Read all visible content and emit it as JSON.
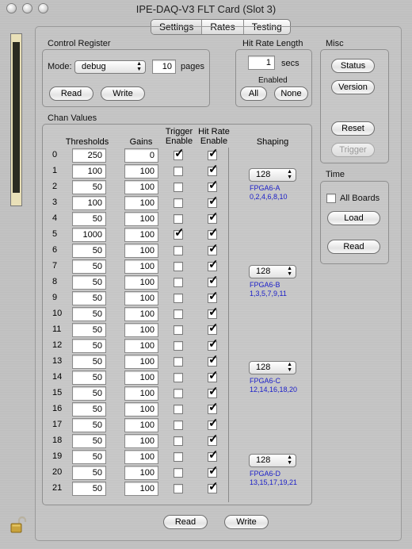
{
  "window": {
    "title": "IPE-DAQ-V3 FLT Card (Slot 3)"
  },
  "tabs": [
    {
      "label": "Settings",
      "selected": true
    },
    {
      "label": "Rates",
      "selected": false
    },
    {
      "label": "Testing",
      "selected": false
    }
  ],
  "control_register": {
    "title": "Control Register",
    "mode_label": "Mode:",
    "mode_value": "debug",
    "pages_value": "10",
    "pages_label": "pages",
    "read_label": "Read",
    "write_label": "Write"
  },
  "hit_rate": {
    "title": "Hit Rate Length",
    "secs_value": "1",
    "secs_label": "secs",
    "enabled_label": "Enabled",
    "all_label": "All",
    "none_label": "None"
  },
  "misc": {
    "title": "Misc",
    "status_label": "Status",
    "version_label": "Version",
    "reset_label": "Reset",
    "trigger_label": "Trigger"
  },
  "time": {
    "title": "Time",
    "all_boards_label": "All Boards",
    "all_boards_checked": false,
    "load_label": "Load",
    "read_label": "Read"
  },
  "chan_values": {
    "title": "Chan Values",
    "headers": {
      "thresholds": "Thresholds",
      "gains": "Gains",
      "trigger": "Trigger\nEnable",
      "hitrate": "Hit Rate\nEnable",
      "shaping": "Shaping"
    },
    "rows": [
      {
        "ch": "0",
        "threshold": "250",
        "gain": "0",
        "trigger": true,
        "hitrate": true
      },
      {
        "ch": "1",
        "threshold": "100",
        "gain": "100",
        "trigger": false,
        "hitrate": true
      },
      {
        "ch": "2",
        "threshold": "50",
        "gain": "100",
        "trigger": false,
        "hitrate": true
      },
      {
        "ch": "3",
        "threshold": "100",
        "gain": "100",
        "trigger": false,
        "hitrate": true
      },
      {
        "ch": "4",
        "threshold": "50",
        "gain": "100",
        "trigger": false,
        "hitrate": true
      },
      {
        "ch": "5",
        "threshold": "1000",
        "gain": "100",
        "trigger": true,
        "hitrate": true
      },
      {
        "ch": "6",
        "threshold": "50",
        "gain": "100",
        "trigger": false,
        "hitrate": true
      },
      {
        "ch": "7",
        "threshold": "50",
        "gain": "100",
        "trigger": false,
        "hitrate": true
      },
      {
        "ch": "8",
        "threshold": "50",
        "gain": "100",
        "trigger": false,
        "hitrate": true
      },
      {
        "ch": "9",
        "threshold": "50",
        "gain": "100",
        "trigger": false,
        "hitrate": true
      },
      {
        "ch": "10",
        "threshold": "50",
        "gain": "100",
        "trigger": false,
        "hitrate": true
      },
      {
        "ch": "11",
        "threshold": "50",
        "gain": "100",
        "trigger": false,
        "hitrate": true
      },
      {
        "ch": "12",
        "threshold": "50",
        "gain": "100",
        "trigger": false,
        "hitrate": true
      },
      {
        "ch": "13",
        "threshold": "50",
        "gain": "100",
        "trigger": false,
        "hitrate": true
      },
      {
        "ch": "14",
        "threshold": "50",
        "gain": "100",
        "trigger": false,
        "hitrate": true
      },
      {
        "ch": "15",
        "threshold": "50",
        "gain": "100",
        "trigger": false,
        "hitrate": true
      },
      {
        "ch": "16",
        "threshold": "50",
        "gain": "100",
        "trigger": false,
        "hitrate": true
      },
      {
        "ch": "17",
        "threshold": "50",
        "gain": "100",
        "trigger": false,
        "hitrate": true
      },
      {
        "ch": "18",
        "threshold": "50",
        "gain": "100",
        "trigger": false,
        "hitrate": true
      },
      {
        "ch": "19",
        "threshold": "50",
        "gain": "100",
        "trigger": false,
        "hitrate": true
      },
      {
        "ch": "20",
        "threshold": "50",
        "gain": "100",
        "trigger": false,
        "hitrate": true
      },
      {
        "ch": "21",
        "threshold": "50",
        "gain": "100",
        "trigger": false,
        "hitrate": true
      }
    ],
    "shaping": [
      {
        "value": "128",
        "fpga": "FPGA6-A",
        "channels": "0,2,4,6,8,10"
      },
      {
        "value": "128",
        "fpga": "FPGA6-B",
        "channels": "1,3,5,7,9,11"
      },
      {
        "value": "128",
        "fpga": "FPGA6-C",
        "channels": "12,14,16,18,20"
      },
      {
        "value": "128",
        "fpga": "FPGA6-D",
        "channels": "13,15,17,19,21"
      }
    ],
    "read_label": "Read",
    "write_label": "Write"
  },
  "colors": {
    "fpga_text": "#1d20c8"
  },
  "icons": {
    "lock": "padlock-icon"
  }
}
